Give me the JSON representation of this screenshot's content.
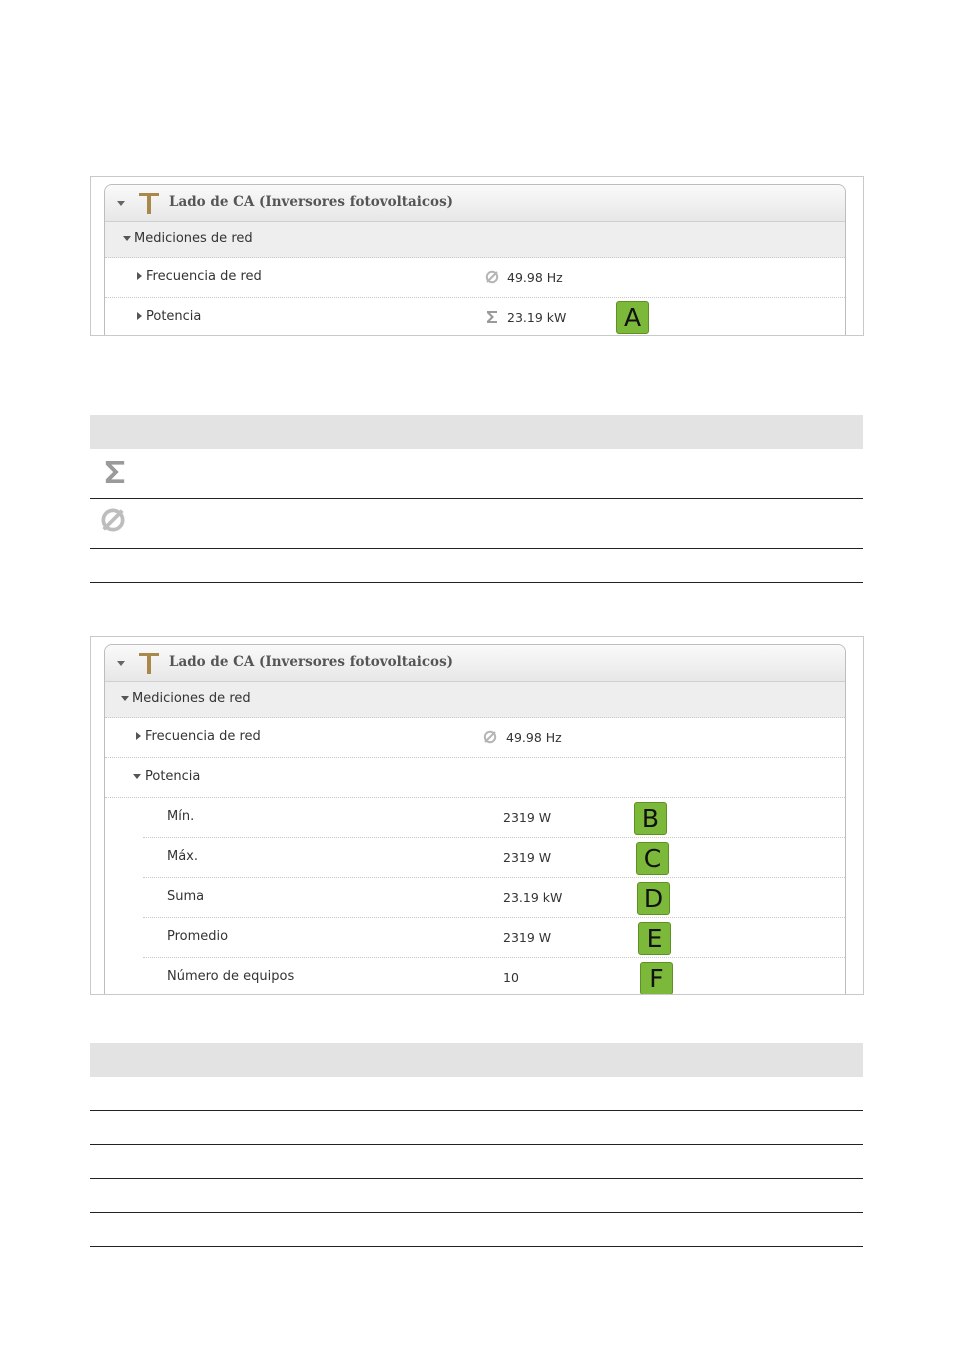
{
  "screenshot1": {
    "panel_title": "Lado de CA  (Inversores fotovoltaicos)",
    "group_label": "Mediciones de red",
    "rows": [
      {
        "label": "Frecuencia de red",
        "value": "49.98 Hz",
        "icon": "average-icon"
      },
      {
        "label": "Potencia",
        "value": "23.19 kW",
        "icon": "sum-icon",
        "badge": "A"
      }
    ]
  },
  "screenshot2": {
    "panel_title": "Lado de CA  (Inversores fotovoltaicos)",
    "group_label": "Mediciones de red",
    "freq_label": "Frecuencia de red",
    "freq_value": "49.98 Hz",
    "potencia_label": "Potencia",
    "subrows": [
      {
        "label": "Mín.",
        "value": "2319 W",
        "badge": "B"
      },
      {
        "label": "Máx.",
        "value": "2319 W",
        "badge": "C"
      },
      {
        "label": "Suma",
        "value": "23.19 kW",
        "badge": "D"
      },
      {
        "label": "Promedio",
        "value": "2319 W",
        "badge": "E"
      },
      {
        "label": "Número de equipos",
        "value": "10",
        "badge": "F"
      }
    ]
  },
  "legend_table_1": {
    "icons": [
      "sum-icon",
      "average-icon"
    ]
  },
  "colors": {
    "badge": "#7cb83a",
    "header_band": "#e3e3e3",
    "icon_gold": "#a8894a"
  }
}
